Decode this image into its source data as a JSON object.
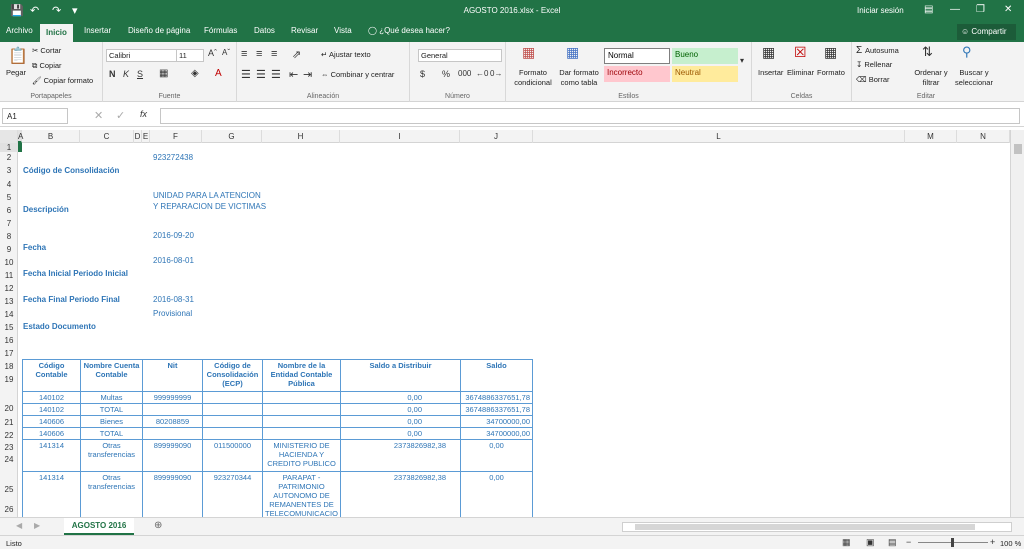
{
  "titlebar": {
    "title": "AGOSTO 2016.xlsx - Excel",
    "signin": "Iniciar sesión"
  },
  "tabs": [
    "Archivo",
    "Inicio",
    "Insertar",
    "Diseño de página",
    "Fórmulas",
    "Datos",
    "Revisar",
    "Vista"
  ],
  "tell_me": "¿Qué desea hacer?",
  "share": "Compartir",
  "ribbon": {
    "clipboard": {
      "paste": "Pegar",
      "cut": "Cortar",
      "copy": "Copiar",
      "format_painter": "Copiar formato",
      "label": "Portapapeles"
    },
    "font": {
      "name": "Calibri",
      "size": "11",
      "label": "Fuente",
      "bold": "N",
      "italic": "K",
      "underline": "S"
    },
    "alignment": {
      "wrap": "Ajustar texto",
      "merge": "Combinar y centrar",
      "label": "Alineación"
    },
    "number": {
      "format": "General",
      "label": "Número"
    },
    "styles": {
      "cond": "Formato condicional",
      "table": "Dar formato como tabla",
      "normal": "Normal",
      "good": "Bueno",
      "bad": "Incorrecto",
      "neutral": "Neutral",
      "label": "Estilos"
    },
    "cells": {
      "insert": "Insertar",
      "delete": "Eliminar",
      "format": "Formato",
      "label": "Celdas"
    },
    "editing": {
      "autosum": "Autosuma",
      "fill": "Rellenar",
      "clear": "Borrar",
      "sort": "Ordenar y filtrar",
      "find": "Buscar y seleccionar",
      "label": "Editar"
    }
  },
  "namebox": "A1",
  "fx": "fx",
  "columns": [
    "A",
    "B",
    "C",
    "D",
    "E",
    "F",
    "G",
    "H",
    "I",
    "J",
    "L",
    "M",
    "N"
  ],
  "rows": [
    "1",
    "2",
    "3",
    "4",
    "5",
    "6",
    "7",
    "8",
    "9",
    "10",
    "11",
    "12",
    "13",
    "14",
    "15",
    "16",
    "17",
    "18",
    "19",
    "20",
    "21",
    "22",
    "23",
    "24",
    "25",
    "26"
  ],
  "cells": {
    "f2": "923272438",
    "b3": "Código de Consolidación",
    "f6a": "UNIDAD PARA LA ATENCION",
    "f6b": "Y REPARACION DE VICTIMAS",
    "b7": "Descripción",
    "f9": "2016-09-20",
    "b10": "Fecha",
    "f11": "2016-08-01",
    "b12": "Fecha Inicial Periodo Inicial",
    "b15": "Fecha Final Periodo Final",
    "f15": "2016-08-31",
    "f16": "Provisional",
    "b17": "Estado Documento"
  },
  "table": {
    "headers": [
      "Código Contable",
      "Nombre Cuenta Contable",
      "Nit",
      "Código de Consolidación (ECP)",
      "Nombre de la Entidad Contable Pública",
      "Saldo a Distribuir",
      "Saldo"
    ],
    "rows": [
      [
        "140102",
        "Multas",
        "999999999",
        "",
        "",
        "0,00",
        "3674886337651,78"
      ],
      [
        "140102",
        "TOTAL",
        "",
        "",
        "",
        "0,00",
        "3674886337651,78"
      ],
      [
        "140606",
        "Bienes",
        "80208859",
        "",
        "",
        "0,00",
        "34700000,00"
      ],
      [
        "140606",
        "TOTAL",
        "",
        "",
        "",
        "0,00",
        "34700000,00"
      ],
      [
        "141314",
        "Otras transferencias",
        "899999090",
        "011500000",
        "MINISTERIO DE HACIENDA Y CREDITO PUBLICO",
        "2373826982,38",
        "0,00"
      ],
      [
        "141314",
        "Otras transferencias",
        "899999090",
        "923270344",
        "PARAPAT - PATRIMONIO AUTONOMO DE REMANENTES DE TELECOMUNICACIO",
        "2373826982,38",
        "0,00"
      ]
    ]
  },
  "sheet_tab": "AGOSTO 2016",
  "status": {
    "ready": "Listo",
    "zoom": "100 %"
  }
}
